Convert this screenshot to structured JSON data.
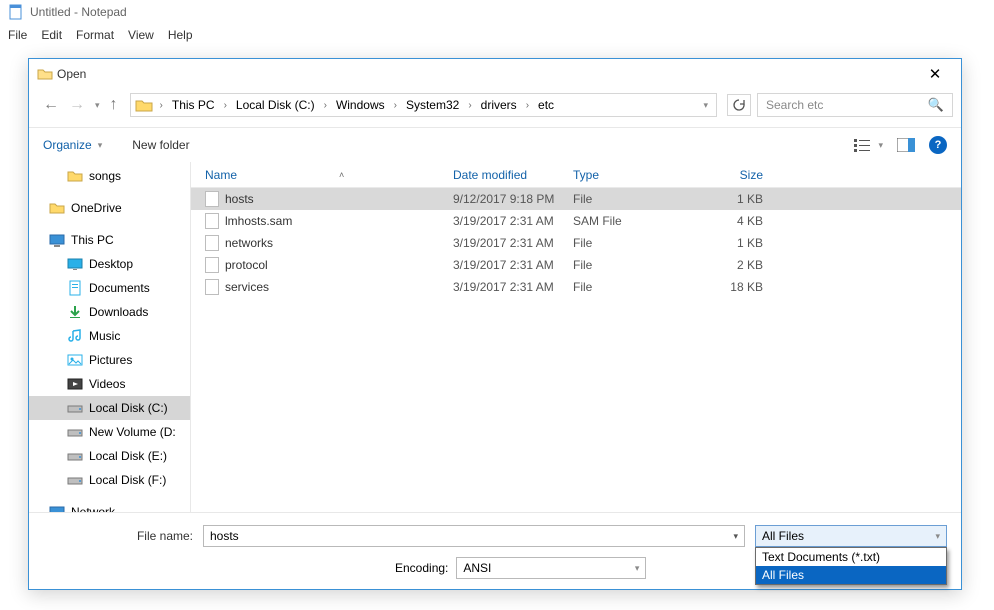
{
  "notepad": {
    "title": "Untitled - Notepad",
    "menu": [
      "File",
      "Edit",
      "Format",
      "View",
      "Help"
    ]
  },
  "dialog": {
    "title": "Open",
    "breadcrumb": [
      "This PC",
      "Local Disk (C:)",
      "Windows",
      "System32",
      "drivers",
      "etc"
    ],
    "search_placeholder": "Search etc",
    "toolbar": {
      "organize": "Organize",
      "new_folder": "New folder"
    },
    "tree": [
      {
        "name": "songs",
        "icon": "folder",
        "indent": true
      },
      {
        "name": "OneDrive",
        "icon": "folder",
        "indent": false
      },
      {
        "name": "This PC",
        "icon": "thispc",
        "indent": false
      },
      {
        "name": "Desktop",
        "icon": "desktop",
        "indent": true
      },
      {
        "name": "Documents",
        "icon": "documents",
        "indent": true
      },
      {
        "name": "Downloads",
        "icon": "downloads",
        "indent": true
      },
      {
        "name": "Music",
        "icon": "music",
        "indent": true
      },
      {
        "name": "Pictures",
        "icon": "pictures",
        "indent": true
      },
      {
        "name": "Videos",
        "icon": "videos",
        "indent": true
      },
      {
        "name": "Local Disk (C:)",
        "icon": "drive",
        "indent": true,
        "selected": true
      },
      {
        "name": "New Volume (D:",
        "icon": "drive",
        "indent": true
      },
      {
        "name": "Local Disk (E:)",
        "icon": "drive",
        "indent": true
      },
      {
        "name": "Local Disk (F:)",
        "icon": "drive",
        "indent": true
      },
      {
        "name": "Network",
        "icon": "network",
        "indent": false
      }
    ],
    "columns": {
      "name": "Name",
      "date": "Date modified",
      "type": "Type",
      "size": "Size"
    },
    "files": [
      {
        "name": "hosts",
        "date": "9/12/2017 9:18 PM",
        "type": "File",
        "size": "1 KB",
        "selected": true
      },
      {
        "name": "lmhosts.sam",
        "date": "3/19/2017 2:31 AM",
        "type": "SAM File",
        "size": "4 KB"
      },
      {
        "name": "networks",
        "date": "3/19/2017 2:31 AM",
        "type": "File",
        "size": "1 KB"
      },
      {
        "name": "protocol",
        "date": "3/19/2017 2:31 AM",
        "type": "File",
        "size": "2 KB"
      },
      {
        "name": "services",
        "date": "3/19/2017 2:31 AM",
        "type": "File",
        "size": "18 KB"
      }
    ],
    "footer": {
      "file_label": "File name:",
      "file_value": "hosts",
      "encoding_label": "Encoding:",
      "encoding_value": "ANSI",
      "filter_selected": "All Files",
      "filter_options": [
        "Text Documents (*.txt)",
        "All Files"
      ]
    }
  }
}
